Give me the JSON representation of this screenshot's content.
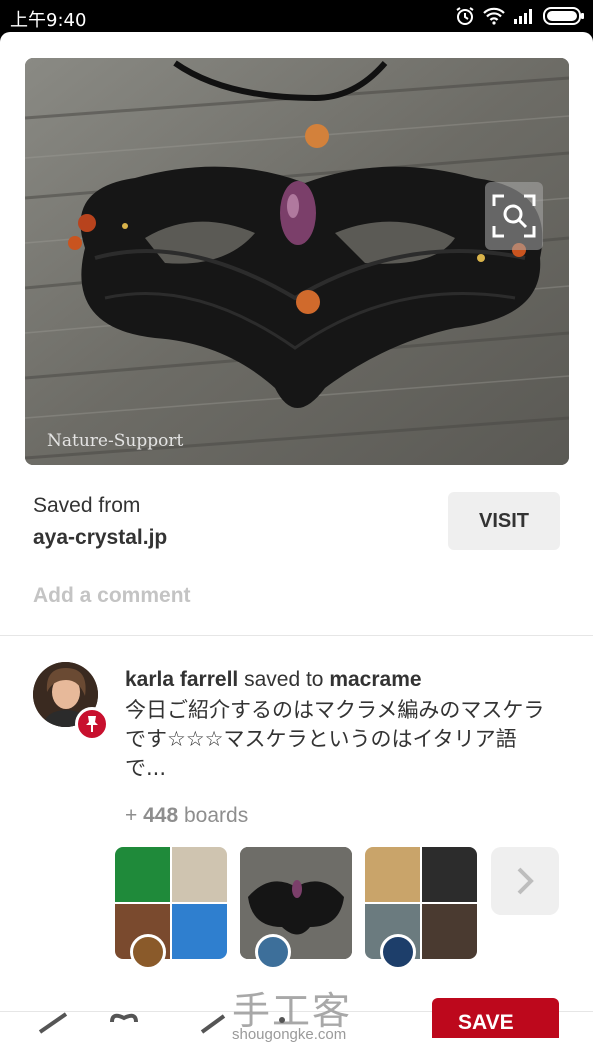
{
  "status_bar": {
    "time": "上午9:40",
    "icons": [
      "alarm-icon",
      "wifi-icon",
      "signal-icon",
      "battery-icon"
    ]
  },
  "pin": {
    "image_watermark": "Nature-Support",
    "saved_from_label": "Saved from",
    "source_domain": "aya-crystal.jp",
    "visit_label": "VISIT",
    "comment_placeholder": "Add a comment"
  },
  "activity": {
    "user": "karla farrell",
    "verb": "saved to",
    "board": "macrame",
    "description": "今日ご紹介するのはマクラメ編みのマスケラです☆☆☆マスケラというのはイタリア語で...",
    "boards_prefix": "+",
    "boards_count": "448",
    "boards_suffix": "boards"
  },
  "actions": {
    "save_label": "SAVE"
  },
  "watermark": {
    "brand": "手工客",
    "url": "shougongke.com"
  },
  "colors": {
    "brand_red": "#bd081c",
    "text": "#333333",
    "muted": "#8e8e8e",
    "button_bg": "#efefef"
  }
}
